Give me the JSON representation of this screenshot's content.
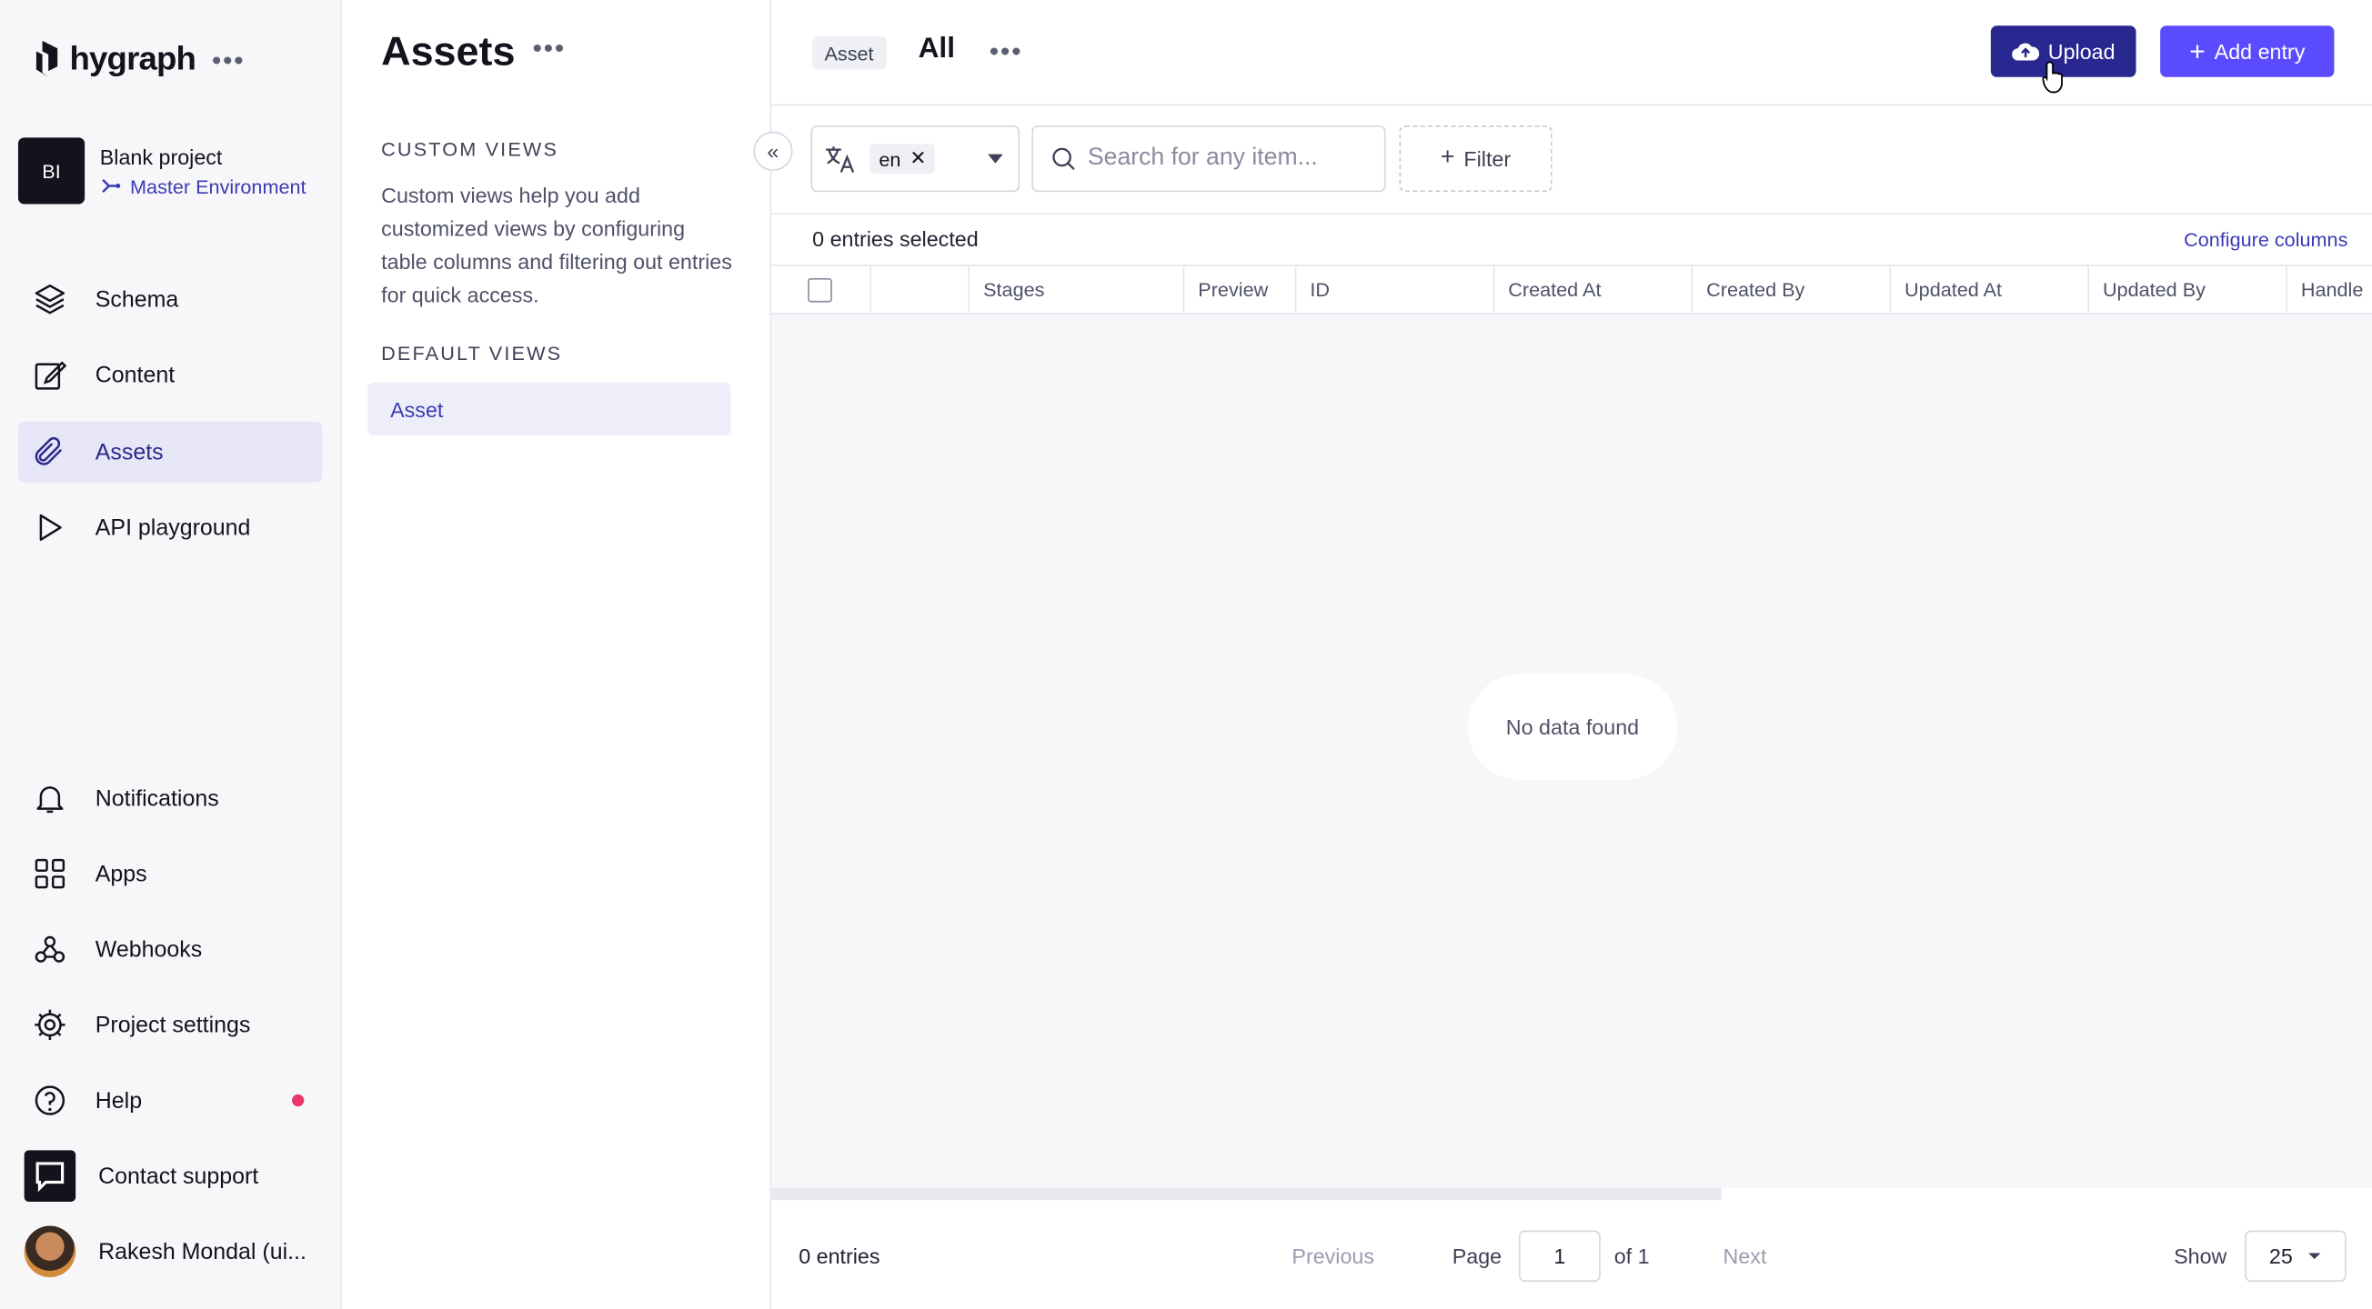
{
  "brand": {
    "name": "hygraph",
    "more_icon": "more-dots-icon"
  },
  "project": {
    "initials": "BI",
    "name": "Blank project",
    "environment": "Master Environment"
  },
  "nav": {
    "items": [
      {
        "label": "Schema",
        "icon": "layers-icon"
      },
      {
        "label": "Content",
        "icon": "edit-icon"
      },
      {
        "label": "Assets",
        "icon": "paperclip-icon",
        "active": true
      },
      {
        "label": "API playground",
        "icon": "play-icon"
      }
    ],
    "bottom": [
      {
        "label": "Notifications",
        "icon": "bell-icon"
      },
      {
        "label": "Apps",
        "icon": "grid-icon"
      },
      {
        "label": "Webhooks",
        "icon": "webhook-icon"
      },
      {
        "label": "Project settings",
        "icon": "gear-icon"
      },
      {
        "label": "Help",
        "icon": "help-icon"
      },
      {
        "label": "Contact support",
        "icon": "chat-icon"
      },
      {
        "label": "Rakesh Mondal (ui...",
        "icon": "avatar"
      }
    ]
  },
  "views_panel": {
    "title": "Assets",
    "custom_label": "CUSTOM VIEWS",
    "custom_desc": "Custom views help you add customized views by configuring table columns and filtering out entries for quick access.",
    "default_label": "DEFAULT VIEWS",
    "default_item": "Asset"
  },
  "header": {
    "badge": "Asset",
    "title": "All",
    "upload_label": "Upload",
    "add_label": "Add entry",
    "colors": {
      "upload": "#27278f",
      "add": "#5b4bff"
    }
  },
  "toolbar": {
    "locale": "en",
    "search_placeholder": "Search for any item...",
    "filter_label": "Filter"
  },
  "table": {
    "selected_text": "0 entries selected",
    "configure_label": "Configure columns",
    "columns": [
      "Stages",
      "Preview",
      "ID",
      "Created At",
      "Created By",
      "Updated At",
      "Updated By",
      "Handle"
    ],
    "empty_text": "No data found"
  },
  "footer": {
    "entries": "0 entries",
    "previous": "Previous",
    "page_label": "Page",
    "page_value": "1",
    "of_text": "of 1",
    "next": "Next",
    "show_label": "Show",
    "page_size": "25"
  }
}
